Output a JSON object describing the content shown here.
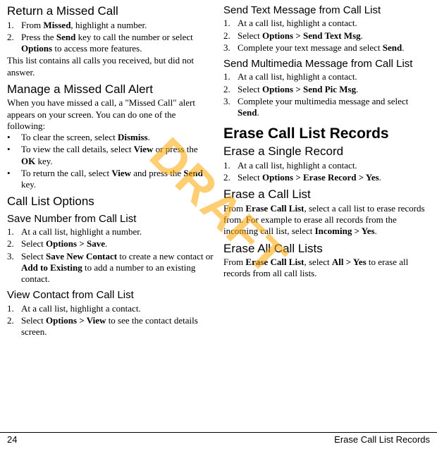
{
  "watermark": "DRAFT",
  "footer": {
    "page": "24",
    "section": "Erase Call List Records"
  },
  "left": {
    "s1": {
      "title": "Return a Missed Call",
      "items": [
        {
          "pre": "From ",
          "b": "Missed",
          "post": ", highlight a number."
        },
        {
          "pre": "Press the ",
          "b": "Send",
          "mid": " key to call the number or select ",
          "b2": "Options",
          "post": " to access more features."
        }
      ],
      "note": "This list contains all calls you received, but did not answer."
    },
    "s2": {
      "title": "Manage a Missed Call Alert",
      "intro": "When you have missed a call, a \"Missed Call\" alert appears on your screen. You can do one of the following:",
      "bullets": [
        {
          "pre": "To clear the screen, select ",
          "b": "Dismiss",
          "post": "."
        },
        {
          "pre": "To view the call details, select ",
          "b": "View",
          "mid": " or press the ",
          "b2": "OK",
          "post": " key."
        },
        {
          "pre": "To return the call, select ",
          "b": "View",
          "mid": " and press the ",
          "b2": "Send",
          "post": " key."
        }
      ]
    },
    "s3": {
      "title": "Call List Options",
      "sub1": {
        "title": "Save Number from Call List",
        "items": [
          {
            "pre": "At a call list, highlight a number."
          },
          {
            "pre": "Select ",
            "b": "Options > Save",
            "post": "."
          },
          {
            "pre": "Select ",
            "b": "Save New Contact",
            "mid": " to create a new contact or ",
            "b2": "Add to Existing",
            "post": " to add a number to an existing contact."
          }
        ]
      },
      "sub2": {
        "title": "View Contact from Call List",
        "items": [
          {
            "pre": "At a call list, highlight a contact."
          },
          {
            "pre": "Select ",
            "b": "Options > View",
            "post": " to see the contact details screen."
          }
        ]
      }
    }
  },
  "right": {
    "s4": {
      "title": "Send Text Message from Call List",
      "items": [
        {
          "pre": "At a call list, highlight a contact."
        },
        {
          "pre": "Select ",
          "b": "Options > Send Text Msg",
          "post": "."
        },
        {
          "pre": "Complete your text message and select ",
          "b": "Send",
          "post": "."
        }
      ]
    },
    "s5": {
      "title": "Send Multimedia Message from Call List",
      "items": [
        {
          "pre": "At a call list, highlight a contact."
        },
        {
          "pre": "Select ",
          "b": "Options > Send Pic Msg",
          "post": "."
        },
        {
          "pre": "Complete your multimedia message and select ",
          "b": "Send",
          "post": "."
        }
      ]
    },
    "s6": {
      "title": "Erase Call List Records",
      "sub1": {
        "title": "Erase a Single Record",
        "items": [
          {
            "pre": "At a call list, highlight a contact."
          },
          {
            "pre": "Select ",
            "b": "Options > Erase Record > Yes",
            "post": "."
          }
        ]
      },
      "sub2": {
        "title": "Erase a Call List",
        "para": {
          "pre": "From ",
          "b": "Erase Call List",
          "mid": ", select a call list to erase records from. For example to erase all records from the incoming call list, select ",
          "b2": "Incoming > Yes",
          "post": "."
        }
      },
      "sub3": {
        "title": "Erase All Call Lists",
        "para": {
          "pre": "From ",
          "b": "Erase Call List",
          "mid": ", select ",
          "b2": "All > Yes",
          "post": " to erase all records from all call lists."
        }
      }
    }
  }
}
